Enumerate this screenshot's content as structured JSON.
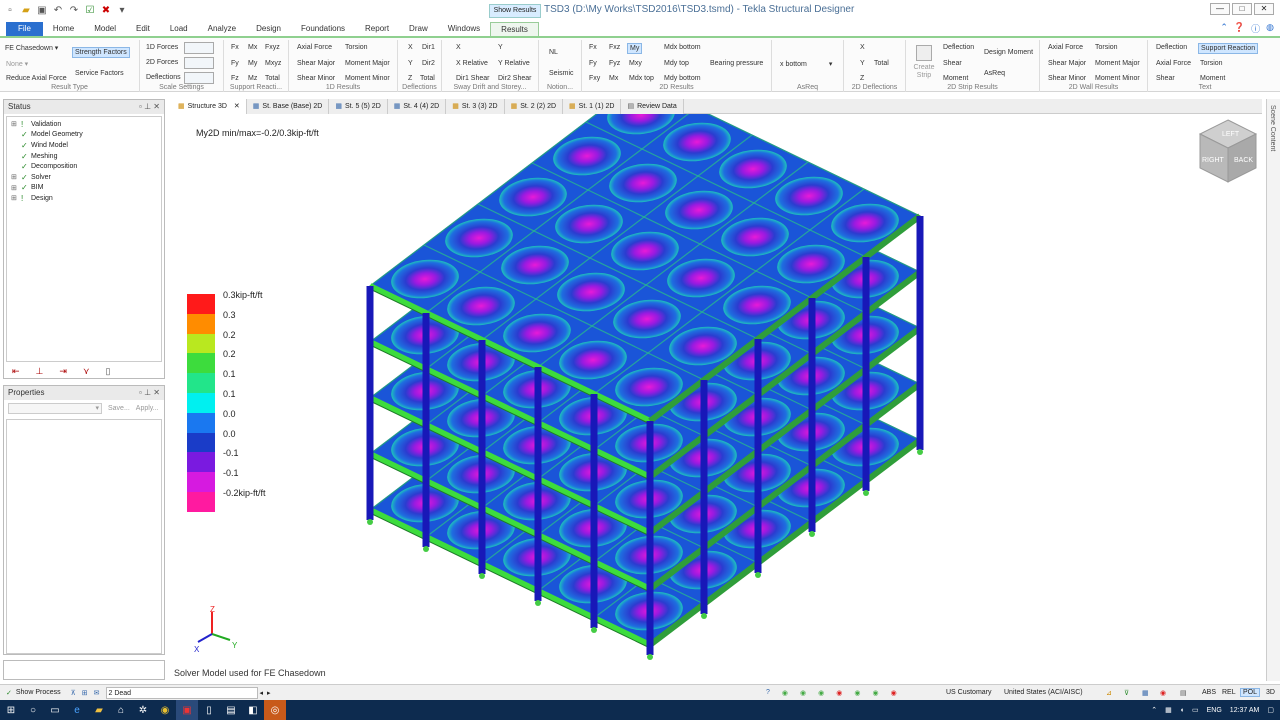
{
  "window": {
    "show_results": "Show Results",
    "title": "TSD3 (D:\\My Works\\TSD2016\\TSD3.tsmd) - Tekla Structural Designer",
    "min": "—",
    "max": "□",
    "close": "✕"
  },
  "tabs": [
    "File",
    "Home",
    "Model",
    "Edit",
    "Load",
    "Analyze",
    "Design",
    "Foundations",
    "Report",
    "Draw",
    "Windows",
    "Results"
  ],
  "ribbon": {
    "result_type": {
      "combo": "FE Chasedown",
      "strength": "Strength Factors",
      "none": "None",
      "service": "Service Factors",
      "reduce": "Reduce Axial Force",
      "caption": "Result Type"
    },
    "scale": {
      "a": "1D Forces",
      "b": "2D Forces",
      "c": "Deflections",
      "caption": "Scale Settings"
    },
    "support": {
      "r1": [
        "Fx",
        "Mx",
        "Fxyz"
      ],
      "r2": [
        "Fy",
        "My",
        "Mxyz"
      ],
      "r3": [
        "Fz",
        "Mz",
        "Total"
      ],
      "caption": "Support Reacti..."
    },
    "oned": {
      "r1": [
        "Axial Force",
        "Torsion"
      ],
      "r2": [
        "Shear Major",
        "Moment Major"
      ],
      "r3": [
        "Shear Minor",
        "Moment Minor"
      ],
      "caption": "1D Results"
    },
    "defl": {
      "r1": [
        "X",
        "Dir1"
      ],
      "r2": [
        "Y",
        "Dir2"
      ],
      "r3": [
        "Z",
        "Total"
      ],
      "caption": "Deflections"
    },
    "sway": {
      "r1": [
        "X",
        "Y"
      ],
      "r2": [
        "X Relative",
        "Y Relative"
      ],
      "r3": [
        "Dir1 Shear",
        "Dir2 Shear"
      ],
      "caption": "Sway Drift and Storey..."
    },
    "notion": {
      "a": "NL",
      "b": "Seismic",
      "caption": "Notion..."
    },
    "twod": {
      "r1": [
        "Fx",
        "Fxz",
        "My",
        "Mdx bottom"
      ],
      "r2": [
        "Fy",
        "Fyz",
        "Mxy",
        "Mdy top",
        "Bearing pressure"
      ],
      "r3": [
        "Fxy",
        "Mx",
        "Mdx top",
        "Mdy bottom"
      ],
      "caption": "2D Results"
    },
    "asreq": {
      "value": "x bottom",
      "caption": "AsReq"
    },
    "twod_defl": {
      "a": "X",
      "b": "Y",
      "b2": "Total",
      "c": "Z",
      "caption": "2D Deflections"
    },
    "strip": {
      "create": "Create Strip",
      "r1": [
        "Deflection",
        "Design Moment"
      ],
      "r2": [
        "Shear",
        "AsReq"
      ],
      "r3": [
        "Moment"
      ],
      "caption": "2D Strip Results"
    },
    "wall": {
      "r1": [
        "Axial Force",
        "Torsion"
      ],
      "r2": [
        "Shear Major",
        "Moment Major"
      ],
      "r3": [
        "Shear Minor",
        "Moment Minor"
      ],
      "caption": "2D Wall Results"
    },
    "text": {
      "r1": [
        "Deflection",
        "Support Reaction"
      ],
      "r2": [
        "Axial Force",
        "Torsion"
      ],
      "r3": [
        "Shear",
        "Moment"
      ],
      "caption": "Text"
    }
  },
  "status_panel": {
    "title": "Status",
    "items": [
      {
        "label": "Validation",
        "icon": "warning"
      },
      {
        "label": "Model Geometry",
        "icon": "check"
      },
      {
        "label": "Wind Model",
        "icon": "check"
      },
      {
        "label": "Meshing",
        "icon": "check"
      },
      {
        "label": "Decomposition",
        "icon": "check"
      },
      {
        "label": "Solver",
        "icon": "check"
      },
      {
        "label": "BIM",
        "icon": "check"
      },
      {
        "label": "Design",
        "icon": "warning"
      }
    ]
  },
  "properties_panel": {
    "title": "Properties",
    "save": "Save...",
    "apply": "Apply..."
  },
  "doc_tabs": [
    "Structure 3D",
    "St. Base (Base) 2D",
    "St. 5 (5) 2D",
    "St. 4 (4) 2D",
    "St. 3 (3) 2D",
    "St. 2 (2) 2D",
    "St. 1 (1) 2D",
    "Review Data"
  ],
  "view": {
    "result_title": "My2D min/max=-0.2/0.3kip-ft/ft",
    "solver_note": "Solver Model used for FE Chasedown",
    "scene_content": "Scene Content",
    "navcube": {
      "top": "LEFT",
      "right": "RIGHT",
      "back": "BACK"
    },
    "axes": {
      "x": "X",
      "y": "Y",
      "z": "Z"
    }
  },
  "legend": [
    {
      "label": "0.3kip-ft/ft",
      "color": "#ff1a1a"
    },
    {
      "label": "0.3",
      "color": "#ff8c00"
    },
    {
      "label": "0.2",
      "color": "#b9e81f"
    },
    {
      "label": "0.2",
      "color": "#3ddc3d"
    },
    {
      "label": "0.1",
      "color": "#22e58a"
    },
    {
      "label": "0.1",
      "color": "#00f0f0"
    },
    {
      "label": "0.0",
      "color": "#1a78f0"
    },
    {
      "label": "0.0",
      "color": "#1a3cc8"
    },
    {
      "label": "-0.1",
      "color": "#7a1ae0"
    },
    {
      "label": "-0.1",
      "color": "#d61ae0"
    },
    {
      "label": "-0.2kip-ft/ft",
      "color": "#ff1aa0"
    }
  ],
  "statusbar": {
    "show_process": "Show Process",
    "loadcase": "2 Dead",
    "units": "US Customary",
    "code": "United States (ACI/AISC)",
    "abs": "ABS",
    "rel": "REL",
    "pol": "POL",
    "threed": "3D"
  },
  "taskbar": {
    "lang": "ENG",
    "time": "12:37 AM"
  }
}
